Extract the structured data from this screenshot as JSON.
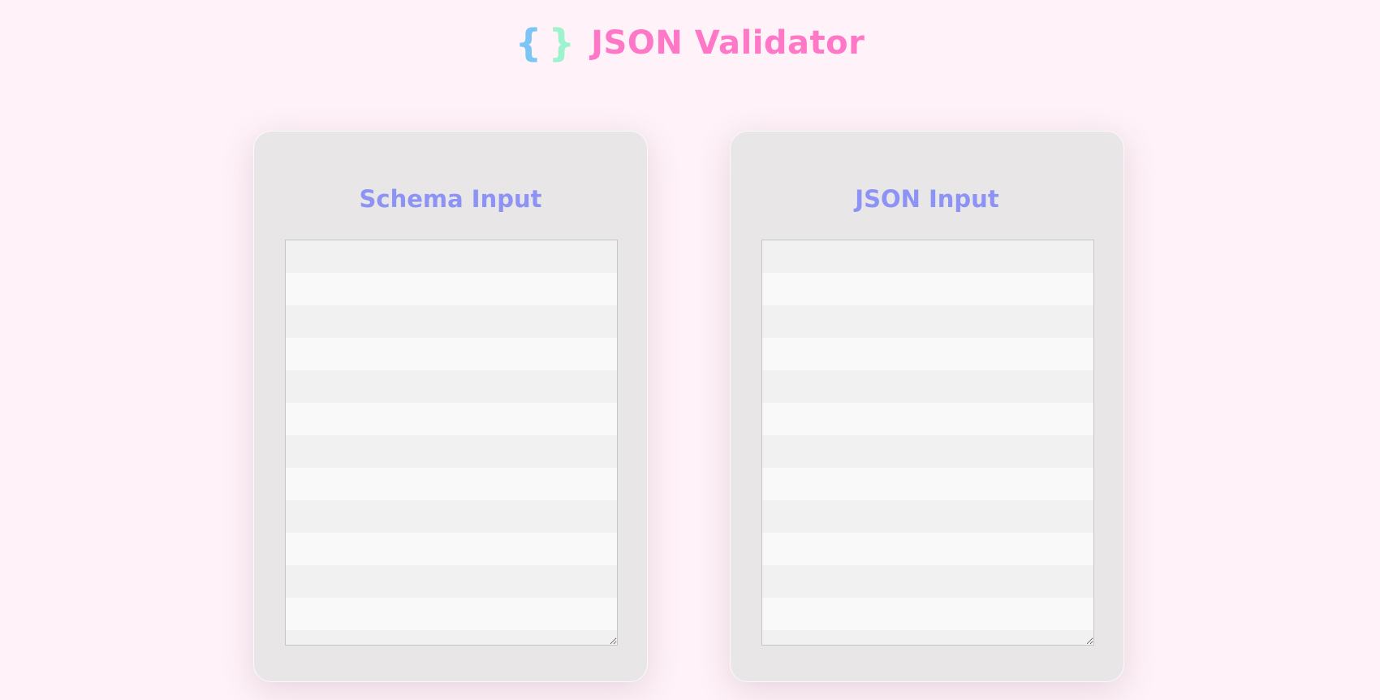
{
  "header": {
    "logo_open": "{",
    "logo_close": "}",
    "title": "JSON Validator"
  },
  "panels": [
    {
      "title": "Schema Input",
      "value": "",
      "placeholder": ""
    },
    {
      "title": "JSON Input",
      "value": "",
      "placeholder": ""
    }
  ],
  "colors": {
    "background": "#fff2f8",
    "title": "#ff78c8",
    "panel_title": "#8c93f4",
    "brace_open": "#7cc6f5",
    "brace_close": "#9ef3cf"
  }
}
